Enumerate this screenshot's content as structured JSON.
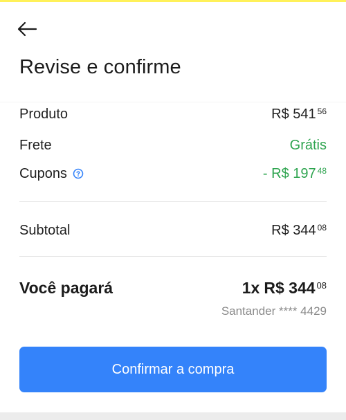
{
  "header": {
    "back_icon": "arrow-left-icon",
    "title": "Revise e confirme"
  },
  "summary": {
    "produto": {
      "label": "Produto",
      "currency": "R$",
      "integer": "541",
      "cents": "56"
    },
    "frete": {
      "label": "Frete",
      "value": "Grátis"
    },
    "cupons": {
      "label": "Cupons",
      "help_icon": "help-circle-icon",
      "prefix": "- R$",
      "integer": "197",
      "cents": "48"
    },
    "subtotal": {
      "label": "Subtotal",
      "currency": "R$",
      "integer": "344",
      "cents": "08"
    }
  },
  "total": {
    "label": "Você pagará",
    "quantity": "1x",
    "currency": "R$",
    "integer": "344",
    "cents": "08",
    "payment_method": "Santander **** 4429"
  },
  "actions": {
    "confirm_label": "Confirmar a compra"
  },
  "colors": {
    "accent_blue": "#3483fa",
    "success_green": "#2ea44f",
    "top_accent_yellow": "#fff159"
  }
}
